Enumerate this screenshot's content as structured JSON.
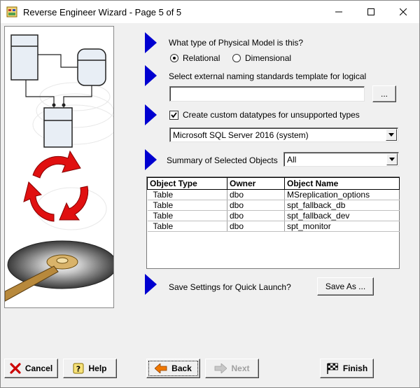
{
  "window": {
    "title": "Reverse Engineer Wizard - Page 5 of 5",
    "minimize_icon": "minimize-icon",
    "maximize_icon": "maximize-icon",
    "close_icon": "close-icon"
  },
  "physical_model": {
    "question": "What type of Physical Model is this?",
    "options": [
      {
        "label": "Relational",
        "selected": true
      },
      {
        "label": "Dimensional",
        "selected": false
      }
    ]
  },
  "naming_standards": {
    "label": "Select external naming standards template for logical",
    "value": "",
    "browse_label": "..."
  },
  "custom_datatypes": {
    "label": "Create custom datatypes for unsupported types",
    "checked": true,
    "selected_db": "Microsoft SQL Server 2016 (system)"
  },
  "summary": {
    "label": "Summary of Selected Objects",
    "filter": "All",
    "columns": [
      "Object Type",
      "Owner",
      "Object Name"
    ],
    "rows": [
      [
        "Table",
        "dbo",
        "MSreplication_options"
      ],
      [
        "Table",
        "dbo",
        "spt_fallback_db"
      ],
      [
        "Table",
        "dbo",
        "spt_fallback_dev"
      ],
      [
        "Table",
        "dbo",
        "spt_monitor"
      ]
    ]
  },
  "quick_launch": {
    "label": "Save Settings for Quick Launch?",
    "save_as_label": "Save As ..."
  },
  "footer": {
    "cancel_label": "Cancel",
    "help_label": "Help",
    "back_label": "Back",
    "next_label": "Next",
    "finish_label": "Finish"
  },
  "colors": {
    "arrow_blue": "#0000d0",
    "cycle_red": "#e01010",
    "cancel_x_red": "#cc0000",
    "back_arrow_orange": "#f07800"
  }
}
